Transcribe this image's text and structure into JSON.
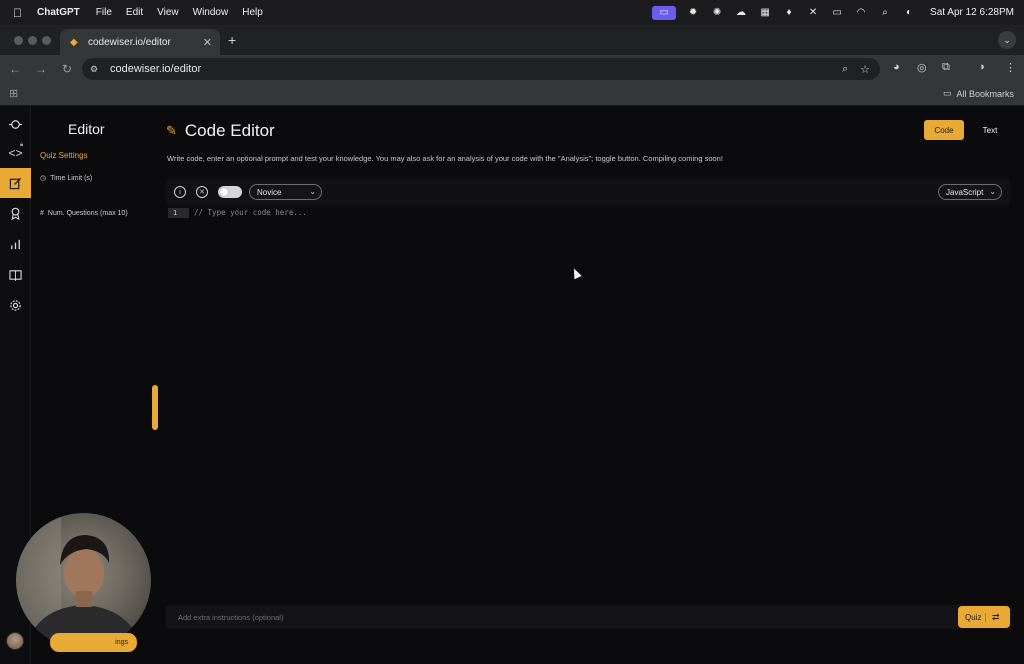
{
  "menubar": {
    "app_name": "ChatGPT",
    "items": [
      "File",
      "Edit",
      "View",
      "Window",
      "Help"
    ],
    "clock": "Sat Apr 12  6:28PM"
  },
  "browser": {
    "tab_title": "codewiser.io/editor",
    "url": "codewiser.io/editor",
    "bookmarks_label": "All Bookmarks"
  },
  "sidebar": {
    "title": "Editor",
    "section": "Quiz Settings",
    "time_limit_label": "Time Limit (s)",
    "num_questions_label": "Num. Questions (max 10)"
  },
  "main": {
    "title": "Code Editor",
    "description": "Write code, enter an optional prompt and test your knowledge. You may also ask for an analysis of your code with the \"Analysis\"; toggle button. Compiling coming soon!",
    "mode_code": "Code",
    "mode_text": "Text",
    "difficulty": "Novice",
    "language": "JavaScript",
    "line_number": "1",
    "code_placeholder": "// Type your code here...",
    "prompt_placeholder": "Add extra instructions (optional)",
    "quiz_button": "Quiz"
  },
  "under_cam_button": "ings",
  "colors": {
    "accent": "#e9a935",
    "background": "#0b0b0d"
  }
}
